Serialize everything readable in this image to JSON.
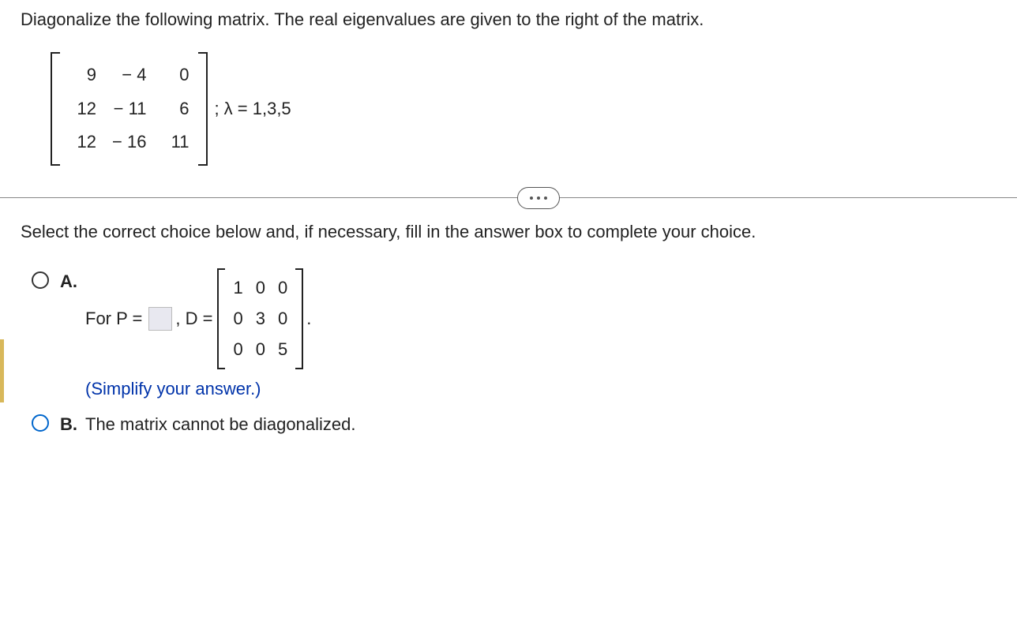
{
  "question": "Diagonalize the following matrix. The real eigenvalues are given to the right of the matrix.",
  "matrix": {
    "r1c1": "9",
    "r1c2": "− 4",
    "r1c3": "0",
    "r2c1": "12",
    "r2c2": "− 11",
    "r2c3": "6",
    "r3c1": "12",
    "r3c2": "− 16",
    "r3c3": "11"
  },
  "lambda_text": "; λ = 1,3,5",
  "select_text": "Select the correct choice below and, if necessary, fill in the answer box to complete your choice.",
  "choices": {
    "a": {
      "label": "A.",
      "for_p": "For P =",
      "d_eq": ", D =",
      "d_matrix": {
        "r1c1": "1",
        "r1c2": "0",
        "r1c3": "0",
        "r2c1": "0",
        "r2c2": "3",
        "r2c3": "0",
        "r3c1": "0",
        "r3c2": "0",
        "r3c3": "5"
      },
      "period": ".",
      "simplify": "(Simplify your answer.)"
    },
    "b": {
      "label": "B.",
      "text": "The matrix cannot be diagonalized."
    }
  }
}
